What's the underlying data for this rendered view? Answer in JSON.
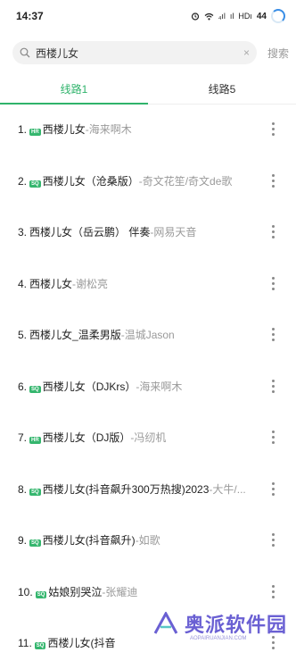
{
  "status_bar": {
    "time": "14:37",
    "icons": [
      "alarm-icon",
      "wifi-icon",
      "signal-icon",
      "signal-icon",
      "hd-icon"
    ],
    "hd_label": "HDı",
    "battery": "44",
    "signal_1": "₄ıl",
    "signal_2": "ıl"
  },
  "search": {
    "value": "西楼儿女",
    "clear": "×",
    "button": "搜索"
  },
  "tabs": [
    {
      "label": "线路1",
      "active": true
    },
    {
      "label": "线路5",
      "active": false
    }
  ],
  "colors": {
    "accent": "#2fb36b",
    "badge": "#35b66e",
    "artist": "#9a9a9a"
  },
  "results": [
    {
      "index": "1.",
      "badge": "HR",
      "title": "西楼儿女",
      "artist": "-海来啊木"
    },
    {
      "index": "2.",
      "badge": "SQ",
      "title": "西楼儿女（沧桑版）",
      "artist": "-奇文花笙/奇文de歌"
    },
    {
      "index": "3.",
      "badge": "",
      "title": "西楼儿女（岳云鹏） 伴奏",
      "artist": "-网易天音"
    },
    {
      "index": "4.",
      "badge": "",
      "title": "西楼儿女",
      "artist": "-谢松亮"
    },
    {
      "index": "5.",
      "badge": "",
      "title": "西楼儿女_温柔男版",
      "artist": "-温城Jason"
    },
    {
      "index": "6.",
      "badge": "SQ",
      "title": "西楼儿女（DJKrs）",
      "artist": "-海来啊木"
    },
    {
      "index": "7.",
      "badge": "HR",
      "title": "西楼儿女（DJ版）",
      "artist": "-冯纫机"
    },
    {
      "index": "8.",
      "badge": "SQ",
      "title": "西楼儿女(抖音飙升300万热搜)2023",
      "artist": "-大牛/..."
    },
    {
      "index": "9.",
      "badge": "SQ",
      "title": "西楼儿女(抖音飙升)",
      "artist": "-如歌"
    },
    {
      "index": "10.",
      "badge": "SQ",
      "title": "姑娘别哭泣",
      "artist": "-张耀迪"
    },
    {
      "index": "11.",
      "badge": "SQ",
      "title": "西楼儿女(抖音",
      "artist": ""
    }
  ],
  "watermark": {
    "text": "奥派软件园",
    "sub": "AOPAIRUANJIAN.COM"
  }
}
